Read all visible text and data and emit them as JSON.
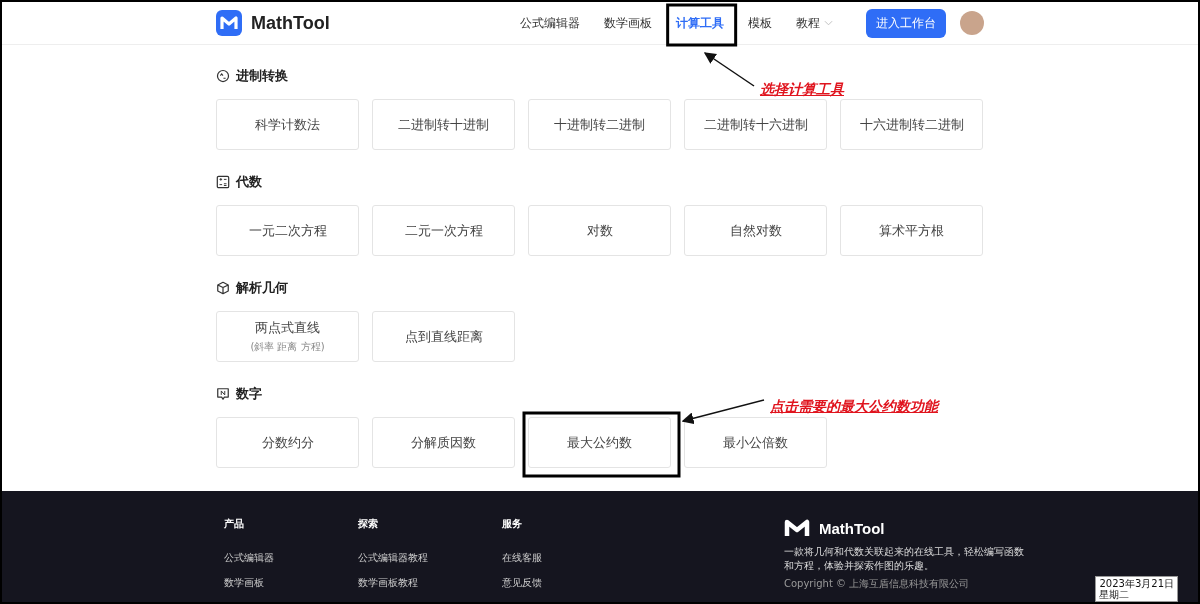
{
  "header": {
    "brand": "MathTool",
    "nav": [
      {
        "label": "公式编辑器",
        "selected": false,
        "dropdown": false
      },
      {
        "label": "数学画板",
        "selected": false,
        "dropdown": false
      },
      {
        "label": "计算工具",
        "selected": true,
        "dropdown": false,
        "callout": "选择计算工具"
      },
      {
        "label": "模板",
        "selected": false,
        "dropdown": false
      },
      {
        "label": "教程",
        "selected": false,
        "dropdown": true
      }
    ],
    "cta": "进入工作台"
  },
  "sections": [
    {
      "kind": "convert",
      "title": "进制转换",
      "tools": [
        {
          "label": "科学计数法"
        },
        {
          "label": "二进制转十进制"
        },
        {
          "label": "十进制转二进制"
        },
        {
          "label": "二进制转十六进制"
        },
        {
          "label": "十六进制转二进制"
        }
      ]
    },
    {
      "kind": "algebra",
      "title": "代数",
      "tools": [
        {
          "label": "一元二次方程"
        },
        {
          "label": "二元一次方程"
        },
        {
          "label": "对数"
        },
        {
          "label": "自然对数"
        },
        {
          "label": "算术平方根"
        }
      ]
    },
    {
      "kind": "geometry",
      "title": "解析几何",
      "tools": [
        {
          "label": "两点式直线",
          "note": "(斜率 距离 方程)"
        },
        {
          "label": "点到直线距离"
        }
      ]
    },
    {
      "kind": "number",
      "title": "数字",
      "tools": [
        {
          "label": "分数约分"
        },
        {
          "label": "分解质因数"
        },
        {
          "label": "最大公约数",
          "callout": "点击需要的最大公约数功能"
        },
        {
          "label": "最小公倍数"
        }
      ]
    }
  ],
  "footer": {
    "columns": [
      {
        "title": "产品",
        "links": [
          "公式编辑器",
          "数学画板"
        ]
      },
      {
        "title": "探索",
        "links": [
          "公式编辑器教程",
          "数学画板教程"
        ]
      },
      {
        "title": "服务",
        "links": [
          "在线客服",
          "意见反馈"
        ]
      }
    ],
    "brand": "MathTool",
    "description": "一款将几何和代数关联起来的在线工具，轻松编写函数和方程，体验并探索作图的乐趣。",
    "copyright": "Copyright © 上海互盾信息科技有限公司"
  },
  "clock": {
    "date": "2023年3月21日",
    "weekday": "星期二"
  }
}
